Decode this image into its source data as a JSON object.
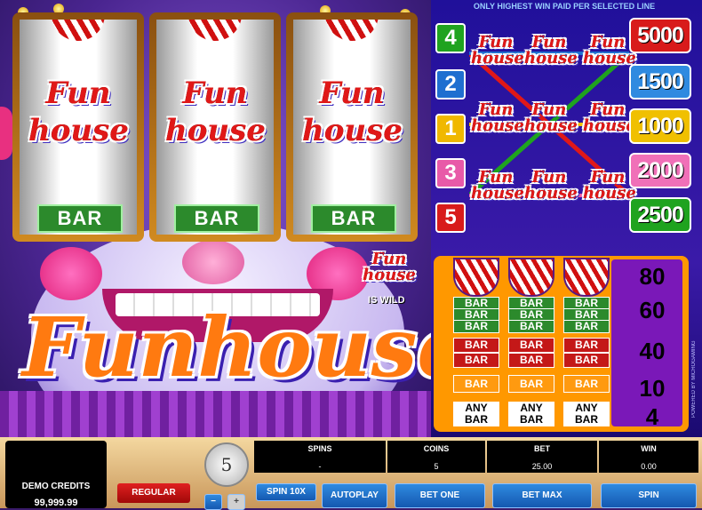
{
  "top_notice": "ONLY HIGHEST WIN PAID PER SELECTED LINE",
  "symbols": {
    "logo_small_top": "Fun",
    "logo_small_bottom": "house",
    "bar": "BAR",
    "any_bar_top": "ANY",
    "any_bar_bottom": "BAR"
  },
  "wild_badge": {
    "logo_top": "Fun",
    "logo_bottom": "house",
    "text": "IS WILD"
  },
  "title_logo": "Funhouse",
  "paylines": [
    {
      "line": "4",
      "payout": "5000",
      "btn_color": "#1fa31f",
      "val_color": "#d81b1b"
    },
    {
      "line": "2",
      "payout": "1500",
      "btn_color": "#1f6fd0",
      "val_color": "#2f8ae0"
    },
    {
      "line": "1",
      "payout": "1000",
      "btn_color": "#f0b800",
      "val_color": "#f0c000"
    },
    {
      "line": "3",
      "payout": "2000",
      "btn_color": "#e85aa8",
      "val_color": "#f070b8"
    },
    {
      "line": "5",
      "payout": "2500",
      "btn_color": "#d81b1b",
      "val_color": "#1fa31f"
    }
  ],
  "paytable": [
    {
      "kind": "icon",
      "payout": "80"
    },
    {
      "kind": "green",
      "payout": "60"
    },
    {
      "kind": "red",
      "payout": "40"
    },
    {
      "kind": "orange",
      "payout": "10"
    },
    {
      "kind": "any",
      "payout": "4"
    }
  ],
  "side_caption": "POWERED BY MICROGAMING",
  "bottom": {
    "demo_credits_label": "DEMO CREDITS",
    "demo_credits_value": "99,999.99",
    "regular_label": "REGULAR",
    "coin_value": "5",
    "spin10x_label": "SPIN 10X",
    "minus": "−",
    "plus": "+",
    "spins_header": "SPINS",
    "spins_value": "-",
    "coins_header": "COINS",
    "coins_value": "5",
    "bet_header": "BET",
    "bet_value": "25.00",
    "win_header": "WIN",
    "win_value": "0.00",
    "autoplay_label": "AUTOPLAY",
    "bet_one_label": "BET ONE",
    "bet_max_label": "BET MAX",
    "spin_label": "SPIN"
  },
  "colors": {
    "bar_green": "#2c8a2c",
    "bar_red": "#c41818",
    "bar_orange": "#ff9a10",
    "paytable_bg": "#ff9800",
    "panel_blue": "#1a0a8a"
  }
}
